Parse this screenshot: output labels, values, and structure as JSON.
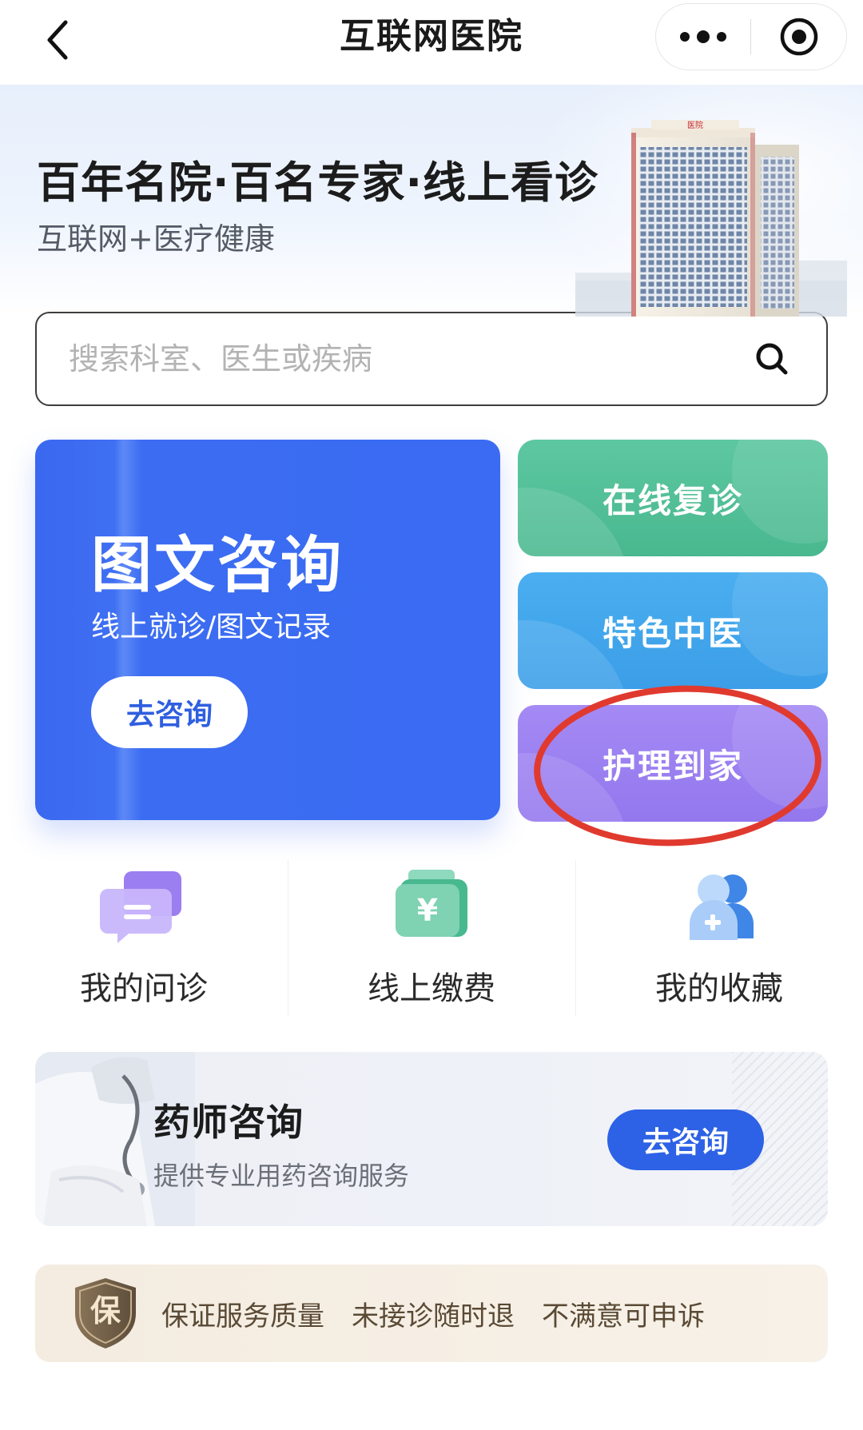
{
  "nav": {
    "title": "互联网医院",
    "back_icon": "chevron-left-icon",
    "more_icon": "more-dots-icon",
    "close_icon": "target-circle-icon"
  },
  "hero": {
    "title": "百年名院·百名专家·线上看诊",
    "subtitle": "互联网+医疗健康",
    "sign_text": "医院"
  },
  "search": {
    "placeholder": "搜索科室、医生或疾病",
    "value": "",
    "icon": "search-icon"
  },
  "main_card": {
    "title": "图文咨询",
    "subtitle": "线上就诊/图文记录",
    "button": "去咨询",
    "color": "#3a6bf2"
  },
  "side_cards": [
    {
      "label": "在线复诊",
      "color": "#4fbd95"
    },
    {
      "label": "特色中医",
      "color": "#40a5ec"
    },
    {
      "label": "护理到家",
      "color": "#9a80f0"
    }
  ],
  "annotation": {
    "shape": "red-ellipse",
    "color": "#e03a2f",
    "target": "护理到家"
  },
  "quick": [
    {
      "label": "我的问诊",
      "icon": "chat-bubble-icon"
    },
    {
      "label": "线上缴费",
      "icon": "yuan-wallet-icon"
    },
    {
      "label": "我的收藏",
      "icon": "user-plus-icon"
    }
  ],
  "pharmacist": {
    "title": "药师咨询",
    "subtitle": "提供专业用药咨询服务",
    "button": "去咨询"
  },
  "guarantee": {
    "badge": "保",
    "items": [
      "保证服务质量",
      "未接诊随时退",
      "不满意可申诉"
    ]
  }
}
